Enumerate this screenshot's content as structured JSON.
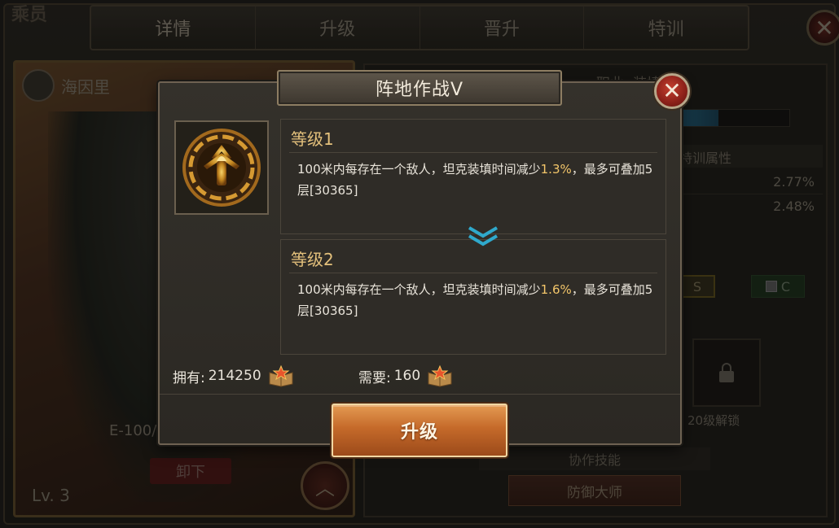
{
  "background": {
    "corner_title": "乘员",
    "tabs": [
      {
        "label": "详情",
        "active": true
      },
      {
        "label": "升级",
        "active": false
      },
      {
        "label": "晋升",
        "active": false
      },
      {
        "label": "特训",
        "active": false
      }
    ],
    "hero": {
      "name": "海因里",
      "tank": "E-100/",
      "unequip_label": "卸下",
      "level_label": "Lv. 3"
    },
    "right_panel": {
      "job_label": "职业: 装填",
      "bar_fill_fraction": 0.35,
      "train_attr_label": "特训属性",
      "attr_values": [
        "2.77%",
        "2.48%"
      ],
      "slot_s": "S",
      "slot_c": "C",
      "unlock_text": "20级解锁",
      "coop_skill_header": "协作技能",
      "coop_skill_button": "防御大师"
    }
  },
  "modal": {
    "title": "阵地作战V",
    "close_icon": "close-x-icon",
    "skill_icon": "shell-emblem-icon",
    "levels": [
      {
        "heading": "等级1",
        "desc_before": "100米内每存在一个敌人，坦克装填时间减少",
        "desc_highlight": "1.3%",
        "desc_after": "，最多可叠加5层[30365]"
      },
      {
        "heading": "等级2",
        "desc_before": "100米内每存在一个敌人，坦克装填时间减少",
        "desc_highlight": "1.6%",
        "desc_after": "，最多可叠加5层[30365]"
      }
    ],
    "divider_icon": "double-chevron-down-icon",
    "owned_label": "拥有:",
    "owned_value": "214250",
    "need_label": "需要:",
    "need_value": "160",
    "resource_icon": "skill-book-icon",
    "upgrade_label": "升级"
  },
  "colors": {
    "highlight": "#f3c66a",
    "level_heading": "#e4c17c",
    "button_orange": "#c56a2a",
    "close_red": "#c43f2e"
  }
}
